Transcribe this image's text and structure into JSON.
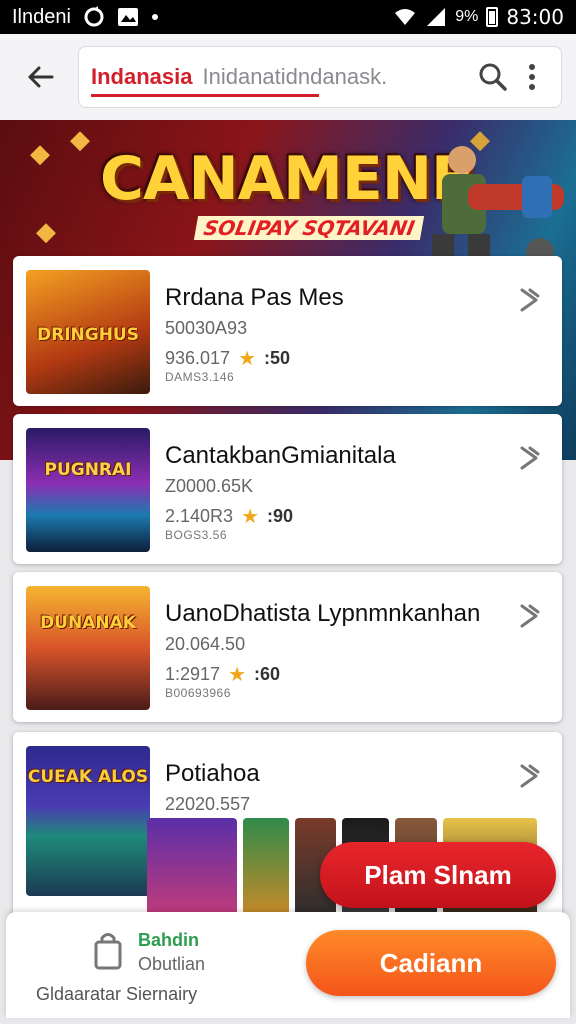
{
  "status_bar": {
    "carrier": "Ilndeni",
    "battery": "9%",
    "time": "83:00"
  },
  "header": {
    "search_scope": "Indanasia",
    "search_query": "Inidanatidndanask.",
    "icons": [
      "back-arrow-icon",
      "search-icon",
      "more-vert-icon"
    ]
  },
  "banner": {
    "title": "CANAMENB",
    "subtitle": "SOLIPAY SQTAVANI"
  },
  "items": [
    {
      "name": "Rrdana Pas Mes",
      "meta1": "50030A93",
      "meta2": "936.017",
      "rating": ":50",
      "meta3": "DAMS3.146",
      "thumb_text": "DRINGHUS"
    },
    {
      "name": "CantakbanGmianitala",
      "meta1": "Z0000.65K",
      "meta2": "2.140R3",
      "rating": ":90",
      "meta3": "BOGS3.56",
      "thumb_text": "PUGNRAI"
    },
    {
      "name": "UanoDhatista Lypnmnkanhan",
      "meta1": "20.064.50",
      "meta2": "1:2917",
      "rating": ":60",
      "meta3": "B00693966",
      "thumb_text": "DUNANAK"
    },
    {
      "name": "Potiahoa",
      "meta1": "22020.557",
      "thumb_text": "CUEAK ALOS"
    }
  ],
  "floating_button": {
    "label": "Plam Slnam"
  },
  "bottom_bar": {
    "line1": "Bahdin",
    "line2": "Obutlian",
    "line3": "Gldaaratar Siernairy",
    "cta_label": "Cadiann"
  },
  "colors": {
    "accent_red": "#d1202a",
    "cta_orange": "#f3551b",
    "star": "#f0a81a",
    "green": "#2e9e4f"
  }
}
